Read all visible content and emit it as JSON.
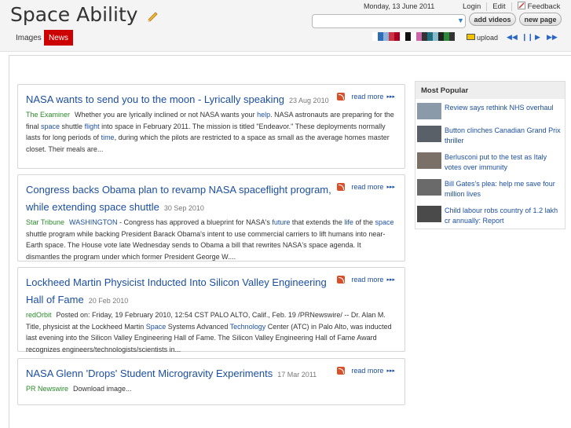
{
  "header": {
    "logo": "Space Ability",
    "date": "Monday, 13 June 2011",
    "links": [
      "Login",
      "Edit",
      "Feedback"
    ],
    "search_placeholder": "",
    "add_videos": "add videos",
    "new_page": "new page",
    "tabs": [
      {
        "label": "Images",
        "active": false
      },
      {
        "label": "News",
        "active": true
      }
    ],
    "upload_label": "upload",
    "swatch_colors": [
      "#ffffff",
      "#2e6db6",
      "#8ab0dc",
      "#cc3344",
      "#aa0022",
      "#ffffff",
      "#111111",
      "#ffffff",
      "#cc66aa",
      "#333333",
      "#1f6f7f",
      "#88bbcc",
      "#222222",
      "#2a8a3a",
      "#333333"
    ]
  },
  "articles": [
    {
      "title": "NASA wants to send you to the moon - Lyrically speaking",
      "date": "23 Aug 2010",
      "source": "The Examiner",
      "read_more": "read more",
      "body_parts": [
        {
          "t": "Whether you are lyrically inclined or not NASA wants your ",
          "k": false
        },
        {
          "t": "help",
          "k": true
        },
        {
          "t": ". NASA astronauts are preparing for the final ",
          "k": false
        },
        {
          "t": "space",
          "k": true
        },
        {
          "t": " shuttle ",
          "k": false
        },
        {
          "t": "flight",
          "k": true
        },
        {
          "t": " into space in February 2011. The mission is titled \"Endeavor.\" These deployments normally lasts for long periods of ",
          "k": false
        },
        {
          "t": "time",
          "k": true
        },
        {
          "t": ", during which the pilots are restricted to a space as small as the average homes master closet. Their meals are...",
          "k": false
        }
      ]
    },
    {
      "title": "Congress backs Obama plan to revamp NASA spaceflight program, while extending space shuttle",
      "date": "30 Sep 2010",
      "source": "Star Tribune",
      "read_more": "read more",
      "body_parts": [
        {
          "t": "WASHINGTON",
          "k": true
        },
        {
          "t": " - Congress has approved a blueprint for NASA's ",
          "k": false
        },
        {
          "t": "future",
          "k": true
        },
        {
          "t": " that extends the ",
          "k": false
        },
        {
          "t": "life",
          "k": true
        },
        {
          "t": " of the ",
          "k": false
        },
        {
          "t": "space",
          "k": true
        },
        {
          "t": " shuttle program while backing President Barack Obama's intent to use commercial carriers to lift humans into near-Earth space. The House vote late Wednesday sends to Obama a bill that rewrites NASA's space agenda. It dismantles the program under which former President George W....",
          "k": false
        }
      ]
    },
    {
      "title": "Lockheed Martin Physicist Inducted Into Silicon Valley Engineering Hall of Fame",
      "date": "20 Feb 2010",
      "source": "redOrbit",
      "read_more": "read more",
      "body_parts": [
        {
          "t": "Posted on: Friday, 19 February 2010, 12:54 CST PALO ALTO, Calif., Feb. 19 /PRNewswire/ -- Dr. Alan M. Title, physicist at the Lockheed Martin ",
          "k": false
        },
        {
          "t": "Space",
          "k": true
        },
        {
          "t": " Systems Advanced ",
          "k": false
        },
        {
          "t": "Technology",
          "k": true
        },
        {
          "t": " Center (ATC) in Palo Alto, was inducted last evening into the Silicon Valley Engineering Hall of Fame. The Silicon Valley Engineering Hall of Fame Award recognizes engineers/technologists/scientists in...",
          "k": false
        }
      ]
    },
    {
      "title": "NASA Glenn 'Drops' Student Microgravity Experiments",
      "date": "17 Mar 2011",
      "source": "PR Newswire",
      "read_more": "read more",
      "body_parts": [
        {
          "t": "Download image...",
          "k": false
        }
      ]
    }
  ],
  "sidebar": {
    "heading": "Most Popular",
    "items": [
      {
        "text": "Review says rethink NHS overhaul",
        "thumb_color": "#8a9aa8"
      },
      {
        "text": "Button clinches Canadian Grand Prix thriller",
        "thumb_color": "#5a6068"
      },
      {
        "text": "Berlusconi put to the test as Italy votes over immunity",
        "thumb_color": "#7a7068"
      },
      {
        "text": "Bill Gates's plea: help me save four million lives",
        "thumb_color": "#6a6a6a"
      },
      {
        "text": "Child labour robs country of 1.2 lakh cr annually: Report",
        "thumb_color": "#4a4a4a"
      }
    ]
  }
}
